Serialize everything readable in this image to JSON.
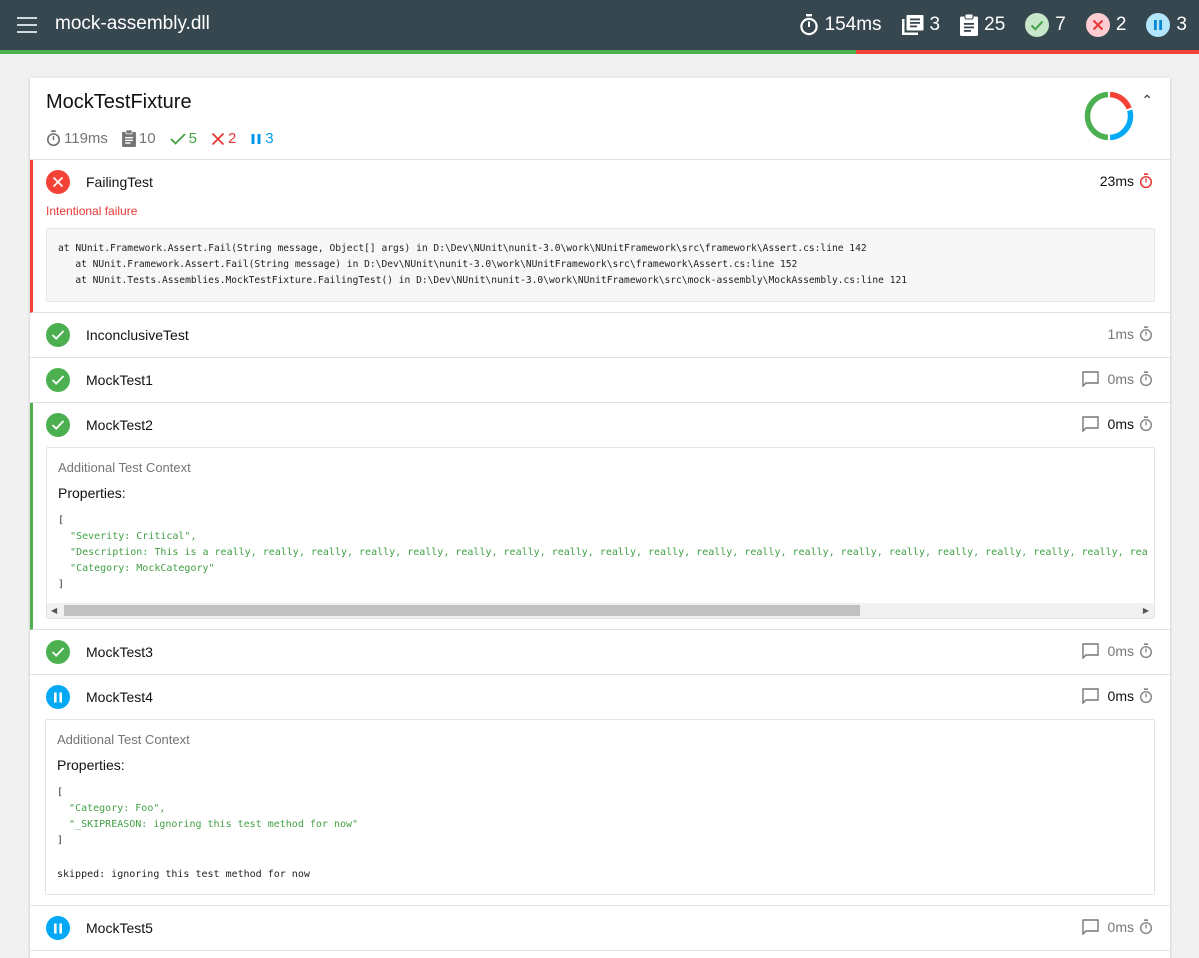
{
  "topbar": {
    "title": "mock-assembly.dll",
    "duration": "154ms",
    "fixtures": "3",
    "tests": "25",
    "passed": "7",
    "failed": "2",
    "skipped": "3",
    "pass_fraction": 0.714,
    "colors": {
      "bg": "#37474f",
      "pass": "#4caf50",
      "fail": "#f44336",
      "skip": "#03a9f4"
    }
  },
  "fixture": {
    "title": "MockTestFixture",
    "duration": "119ms",
    "tests": "10",
    "passed": "5",
    "failed": "2",
    "skipped": "3",
    "donut": {
      "pass": 5,
      "fail": 2,
      "skip": 3
    }
  },
  "tests": [
    {
      "name": "FailingTest",
      "status": "fail",
      "duration": "23ms",
      "message": "Intentional failure",
      "stack": "at NUnit.Framework.Assert.Fail(String message, Object[] args) in D:\\Dev\\NUnit\\nunit-3.0\\work\\NUnitFramework\\src\\framework\\Assert.cs:line 142\n   at NUnit.Framework.Assert.Fail(String message) in D:\\Dev\\NUnit\\nunit-3.0\\work\\NUnitFramework\\src\\framework\\Assert.cs:line 152\n   at NUnit.Tests.Assemblies.MockTestFixture.FailingTest() in D:\\Dev\\NUnit\\nunit-3.0\\work\\NUnitFramework\\src\\mock-assembly\\MockAssembly.cs:line 121"
    },
    {
      "name": "InconclusiveTest",
      "status": "pass",
      "duration": "1ms"
    },
    {
      "name": "MockTest1",
      "status": "pass",
      "duration": "0ms"
    },
    {
      "name": "MockTest2",
      "status": "pass",
      "duration": "0ms",
      "context_title": "Additional Test Context",
      "properties_label": "Properties:",
      "properties": [
        "\"Severity: Critical\",",
        "\"Description: This is a really, really, really, really, really, really, really, really, really, really, really, really, really, really, really, really, really, really, really, rea",
        "\"Category: MockCategory\""
      ]
    },
    {
      "name": "MockTest3",
      "status": "pass",
      "duration": "0ms"
    },
    {
      "name": "MockTest4",
      "status": "skip",
      "duration": "0ms",
      "context_title": "Additional Test Context",
      "properties_label": "Properties:",
      "properties": [
        "\"Category: Foo\",",
        "\"_SKIPREASON: ignoring this test method for now\""
      ],
      "skip_message": "skipped: ignoring this test method for now"
    },
    {
      "name": "MockTest5",
      "status": "skip",
      "duration": "0ms"
    }
  ],
  "code": {
    "open": "[",
    "close": "]"
  }
}
